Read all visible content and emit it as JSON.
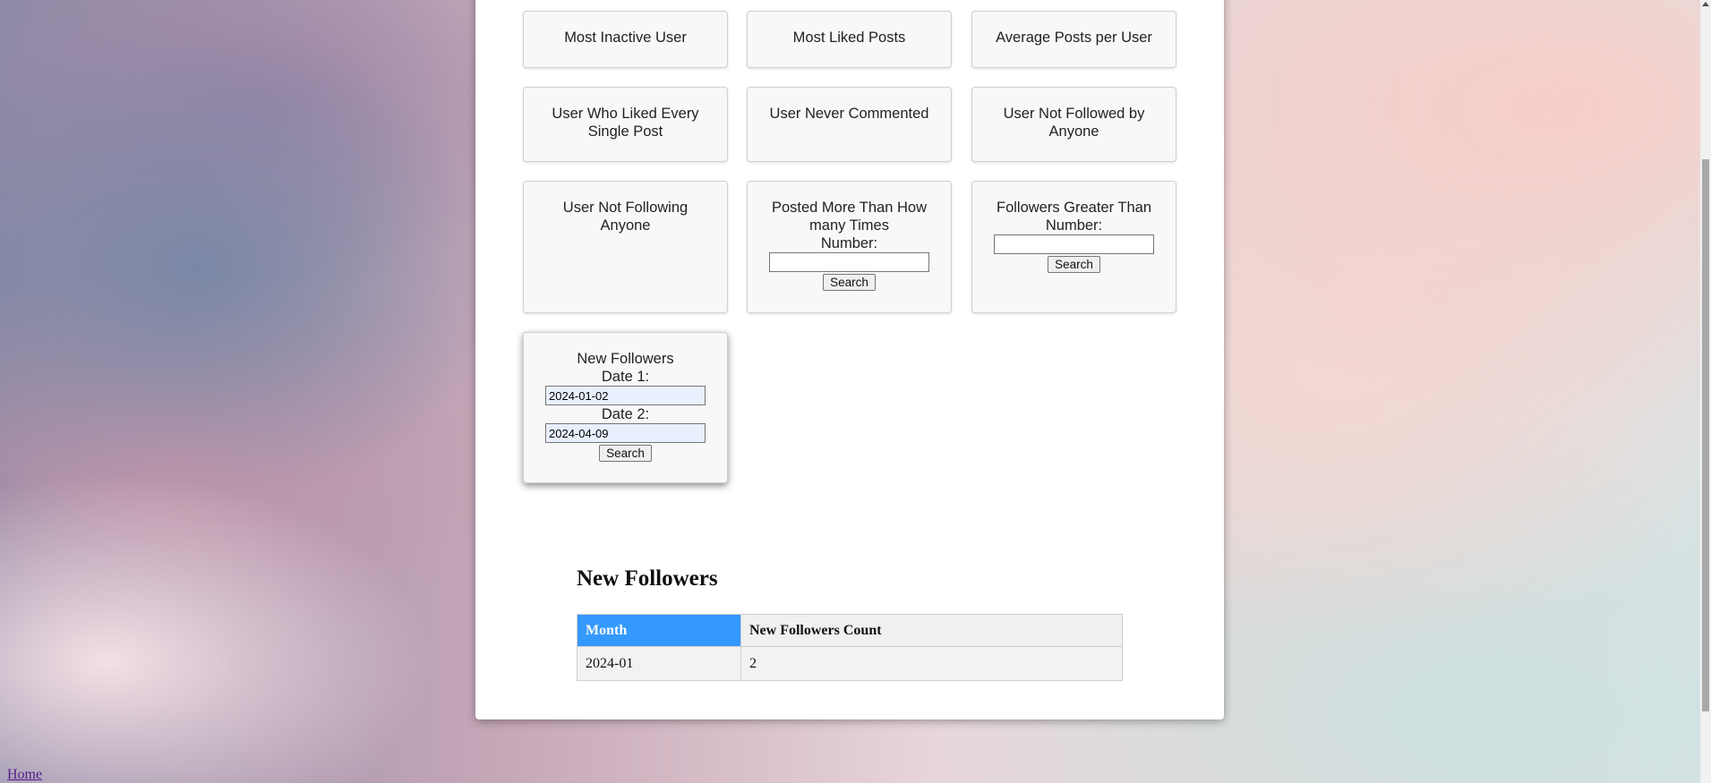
{
  "query_cards": [
    {
      "label": "Most Inactive User"
    },
    {
      "label": "Most Liked Posts"
    },
    {
      "label": "Average Posts per User"
    },
    {
      "label": "User Who Liked Every Single Post"
    },
    {
      "label": "User Never Commented"
    },
    {
      "label": "User Not Followed by Anyone"
    },
    {
      "label": "User Not Following Anyone"
    }
  ],
  "posted_more": {
    "title": "Posted More Than How many Times",
    "number_label": "Number:",
    "number_value": "",
    "button": "Search"
  },
  "followers_greater": {
    "title": "Followers Greater Than",
    "number_label": "Number:",
    "number_value": "",
    "button": "Search"
  },
  "new_followers_form": {
    "title": "New Followers",
    "date1_label": "Date 1:",
    "date1_value": "2024-01-02",
    "date2_label": "Date 2:",
    "date2_value": "2024-04-09",
    "button": "Search"
  },
  "results": {
    "title": "New Followers",
    "columns": [
      "Month",
      "New Followers Count"
    ],
    "rows": [
      [
        "2024-01",
        "2"
      ]
    ]
  },
  "footer": {
    "home_link": "Home"
  },
  "colors": {
    "header_highlight": "#3399ff",
    "link": "#551a8b"
  }
}
